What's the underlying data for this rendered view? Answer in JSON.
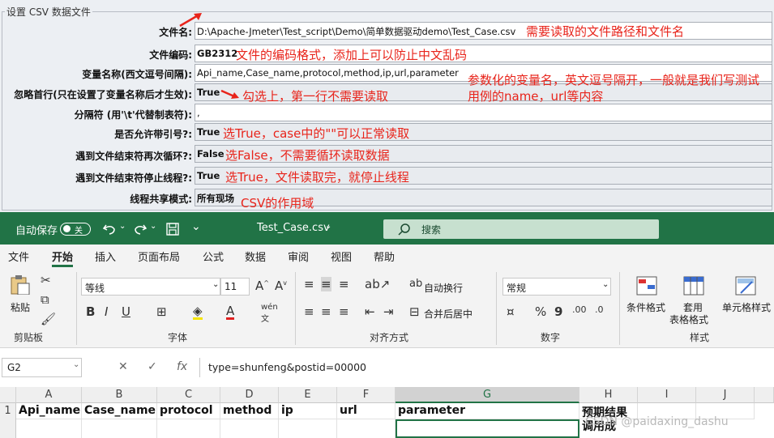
{
  "csv_panel": {
    "title": "设置 CSV 数据文件",
    "rows": [
      {
        "label": "文件名:",
        "value": "D:\\Apache-Jmeter\\Test_script\\Demo\\简单数据驱动demo\\Test_Case.csv",
        "note": "需要读取的文件路径和文件名"
      },
      {
        "label": "文件编码:",
        "value": "GB2312",
        "note": "文件的编码格式，添加上可以防止中文乱码"
      },
      {
        "label": "变量名称(西文逗号间隔):",
        "value": "Api_name,Case_name,protocol,method,ip,url,parameter",
        "note": "参数化的变量名，英文逗号隔开，一般就是我们写测试用例的name，url等内容"
      },
      {
        "label": "忽略首行(只在设置了变量名称后才生效):",
        "value": "True",
        "note": "勾选上，第一行不需要读取"
      },
      {
        "label": "分隔符 (用'\\t'代替制表符):",
        "value": ",",
        "note": ""
      },
      {
        "label": "是否允许带引号?:",
        "value": "True",
        "note": "选True，case中的\"\"可以正常读取"
      },
      {
        "label": "遇到文件结束符再次循环?:",
        "value": "False",
        "note": "选False，不需要循环读取数据"
      },
      {
        "label": "遇到文件结束符停止线程?:",
        "value": "True",
        "note": "选True，文件读取完，就停止线程"
      },
      {
        "label": "线程共享模式:",
        "value": "所有现场",
        "note": "CSV的作用域"
      }
    ]
  },
  "excel": {
    "autosave_label": "自动保存",
    "autosave_state": "关",
    "filename": "Test_Case.csv",
    "search_placeholder": "搜索",
    "menu": [
      "文件",
      "开始",
      "插入",
      "页面布局",
      "公式",
      "数据",
      "审阅",
      "视图",
      "帮助"
    ],
    "ribbon": {
      "paste": "粘贴",
      "clipboard": "剪贴板",
      "font_name": "等线",
      "font_size": "11",
      "font_group": "字体",
      "wrap_text": "自动换行",
      "merge_center": "合并后居中",
      "alignment_group": "对齐方式",
      "number_format": "常规",
      "number_group": "数字",
      "conditional_format": "条件格式",
      "table_format_1": "套用",
      "table_format_2": "表格格式",
      "cell_styles": "单元格样式",
      "styles_group": "样式"
    },
    "name_box": "G2",
    "formula": "type=shunfeng&postid=00000",
    "columns": [
      "A",
      "B",
      "C",
      "D",
      "E",
      "F",
      "G",
      "H",
      "I",
      "J"
    ],
    "row1": [
      "Api_name",
      "Case_name",
      "protocol",
      "method",
      "ip",
      "url",
      "parameter",
      "预期结果",
      "",
      ""
    ],
    "row2_h": "调用成",
    "watermark": "CSDN @paidaxing_dashu"
  },
  "colors": {
    "accent": "#217346",
    "annotation": "#e8241b"
  }
}
